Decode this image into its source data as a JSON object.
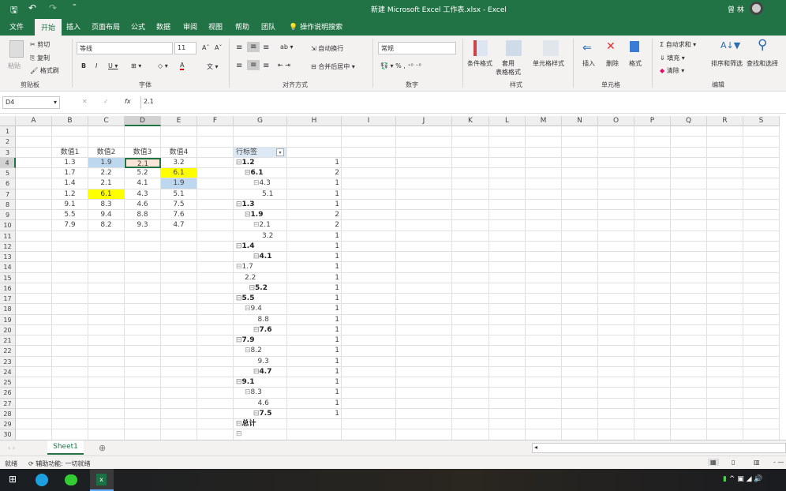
{
  "title": "新建 Microsoft Excel 工作表.xlsx  -  Excel",
  "user": "曾 林",
  "menu": [
    "文件",
    "开始",
    "插入",
    "页面布局",
    "公式",
    "数据",
    "审阅",
    "视图",
    "帮助",
    "团队"
  ],
  "search_label": "操作说明搜索",
  "ribbon": {
    "paste": "粘贴",
    "cut": "剪切",
    "copy": "复制",
    "format_painter": "格式刷",
    "clipboard": "剪贴板",
    "font_name": "等线",
    "font_size": "11",
    "font_group": "字体",
    "wrap": "自动换行",
    "merge": "合并后居中",
    "align_group": "对齐方式",
    "number_format": "常规",
    "number_group": "数字",
    "cond_format": "条件格式",
    "table_format": "套用\n表格格式",
    "cell_style": "单元格样式",
    "styles_group": "样式",
    "insert": "插入",
    "delete": "删除",
    "format": "格式",
    "cells_group": "单元格",
    "autosum": "自动求和",
    "fill": "填充",
    "clear": "清除",
    "sort": "排序和筛选",
    "find": "查找和选择",
    "edit_group": "编辑"
  },
  "namebox": "D4",
  "formula": "2.1",
  "columns": [
    "A",
    "B",
    "C",
    "D",
    "E",
    "F",
    "G",
    "H",
    "I",
    "J",
    "K",
    "L",
    "M",
    "N",
    "O",
    "P",
    "Q",
    "R",
    "S"
  ],
  "headers": [
    "数值1",
    "数值2",
    "数值3",
    "数值4"
  ],
  "table": [
    [
      "1.3",
      "1.9",
      "2.1",
      "3.2"
    ],
    [
      "1.7",
      "2.2",
      "5.2",
      "6.1"
    ],
    [
      "1.4",
      "2.1",
      "4.1",
      "1.9"
    ],
    [
      "1.2",
      "6.1",
      "4.3",
      "5.1"
    ],
    [
      "9.1",
      "8.3",
      "4.6",
      "7.5"
    ],
    [
      "5.5",
      "9.4",
      "8.8",
      "7.6"
    ],
    [
      "7.9",
      "8.2",
      "9.3",
      "4.7"
    ]
  ],
  "highlight_colors": {
    "blue": "#bdd7ee",
    "yellow": "#ffff00",
    "peach": "#fce4d6"
  },
  "pivot_header": "行标签",
  "pivot": [
    {
      "label": "1.2",
      "level": 0,
      "bold": true,
      "toggle": true,
      "count": "1"
    },
    {
      "label": "6.1",
      "level": 1,
      "bold": true,
      "toggle": true,
      "count": "2"
    },
    {
      "label": "4.3",
      "level": 2,
      "bold": false,
      "toggle": true,
      "count": "1"
    },
    {
      "label": "5.1",
      "level": 3,
      "bold": false,
      "toggle": false,
      "count": "1"
    },
    {
      "label": "1.3",
      "level": 0,
      "bold": true,
      "toggle": true,
      "count": "1"
    },
    {
      "label": "1.9",
      "level": 1,
      "bold": true,
      "toggle": true,
      "count": "2"
    },
    {
      "label": "2.1",
      "level": 2,
      "bold": false,
      "toggle": true,
      "count": "2"
    },
    {
      "label": "3.2",
      "level": 3,
      "bold": false,
      "toggle": false,
      "count": "1"
    },
    {
      "label": "1.4",
      "level": 0,
      "bold": true,
      "toggle": true,
      "count": "1"
    },
    {
      "label": "4.1",
      "level": 2,
      "bold": true,
      "toggle": true,
      "count": "1"
    },
    {
      "label": "1.7",
      "level": 0,
      "bold": false,
      "toggle": true,
      "count": "1"
    },
    {
      "label": "2.2",
      "level": 1,
      "bold": false,
      "toggle": false,
      "count": "1"
    },
    {
      "label": "5.2",
      "level": 1.5,
      "bold": true,
      "toggle": true,
      "count": "1"
    },
    {
      "label": "5.5",
      "level": 0,
      "bold": true,
      "toggle": true,
      "count": "1"
    },
    {
      "label": "9.4",
      "level": 1,
      "bold": false,
      "toggle": true,
      "count": "1"
    },
    {
      "label": "8.8",
      "level": 2.5,
      "bold": false,
      "toggle": false,
      "count": "1"
    },
    {
      "label": "7.6",
      "level": 2,
      "bold": true,
      "toggle": true,
      "count": "1"
    },
    {
      "label": "7.9",
      "level": 0,
      "bold": true,
      "toggle": true,
      "count": "1"
    },
    {
      "label": "8.2",
      "level": 1,
      "bold": false,
      "toggle": true,
      "count": "1"
    },
    {
      "label": "9.3",
      "level": 2.5,
      "bold": false,
      "toggle": false,
      "count": "1"
    },
    {
      "label": "4.7",
      "level": 2,
      "bold": true,
      "toggle": true,
      "count": "1"
    },
    {
      "label": "9.1",
      "level": 0,
      "bold": true,
      "toggle": true,
      "count": "1"
    },
    {
      "label": "8.3",
      "level": 1,
      "bold": false,
      "toggle": true,
      "count": "1"
    },
    {
      "label": "4.6",
      "level": 2.5,
      "bold": false,
      "toggle": false,
      "count": "1"
    },
    {
      "label": "7.5",
      "level": 2,
      "bold": true,
      "toggle": true,
      "count": "1"
    },
    {
      "label": "总计",
      "level": 0,
      "bold": true,
      "toggle": true,
      "count": ""
    },
    {
      "label": "",
      "level": 0,
      "bold": false,
      "toggle": true,
      "count": ""
    }
  ],
  "sheet_tab": "Sheet1",
  "status": "就绪",
  "accessibility": "辅助功能: 一切就绪"
}
